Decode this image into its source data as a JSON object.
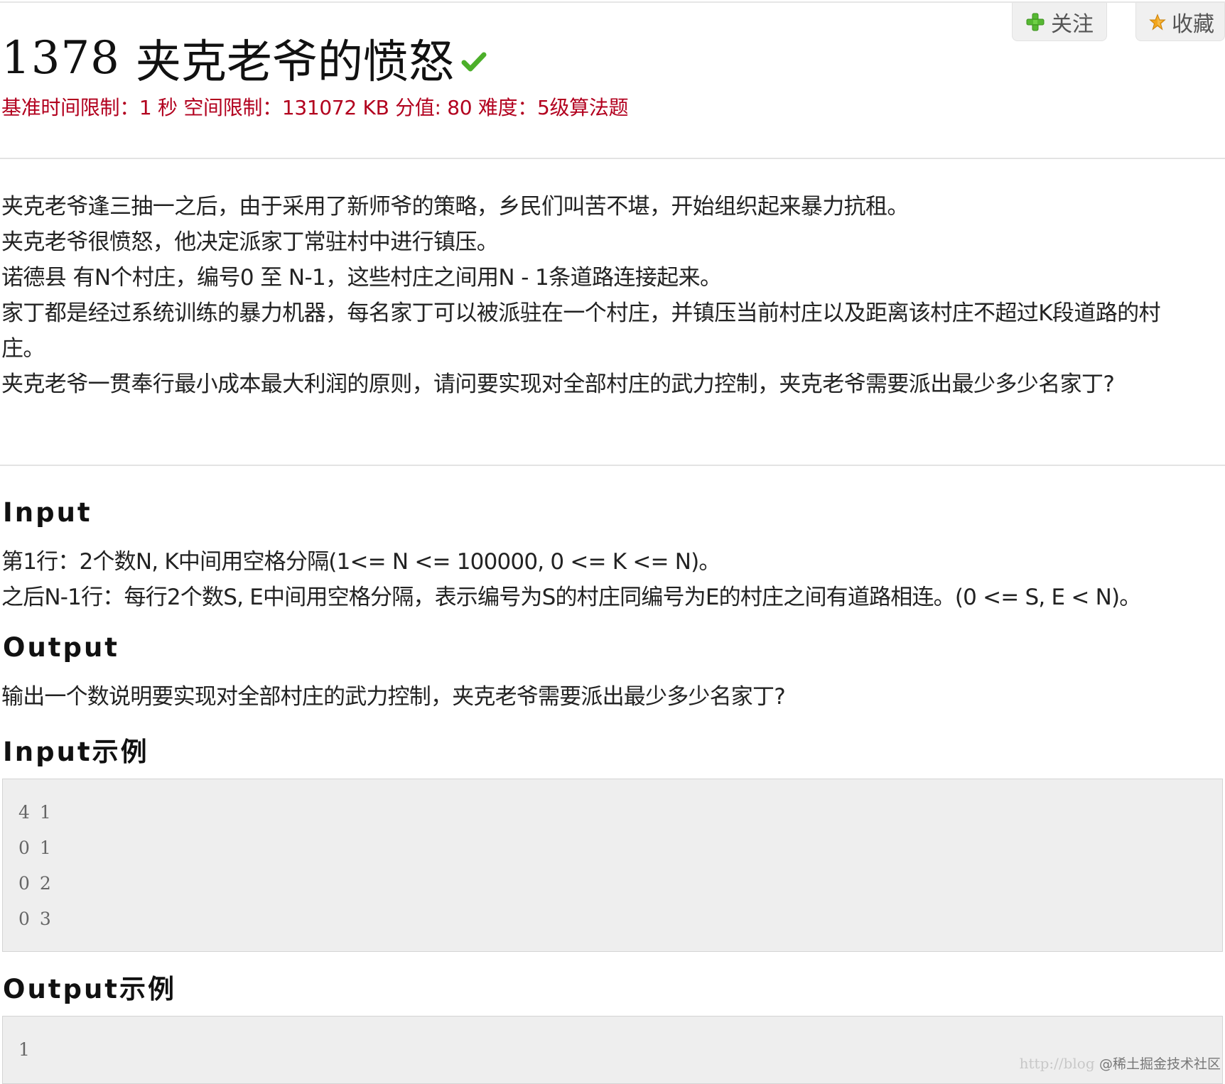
{
  "actions": {
    "follow_label": "关注",
    "favorite_label": "收藏"
  },
  "problem": {
    "id": "1378",
    "title": "夹克老爷的愤怒",
    "meta": "基准时间限制：1 秒 空间限制：131072 KB 分值: 80 难度：5级算法题"
  },
  "description": [
    "夹克老爷逢三抽一之后，由于采用了新师爷的策略，乡民们叫苦不堪，开始组织起来暴力抗租。",
    "夹克老爷很愤怒，他决定派家丁常驻村中进行镇压。",
    "诺德县 有N个村庄，编号0 至 N-1，这些村庄之间用N - 1条道路连接起来。",
    "家丁都是经过系统训练的暴力机器，每名家丁可以被派驻在一个村庄，并镇压当前村庄以及距离该村庄不超过K段道路的村",
    "庄。",
    "夹克老爷一贯奉行最小成本最大利润的原则，请问要实现对全部村庄的武力控制，夹克老爷需要派出最少多少名家丁?"
  ],
  "input_section": {
    "heading": "Input",
    "lines": [
      "第1行：2个数N, K中间用空格分隔(1<= N <= 100000, 0 <= K <= N)。",
      "之后N-1行：每行2个数S, E中间用空格分隔，表示编号为S的村庄同编号为E的村庄之间有道路相连。(0 <= S, E < N)。"
    ]
  },
  "output_section": {
    "heading": "Output",
    "lines": [
      "输出一个数说明要实现对全部村庄的武力控制，夹克老爷需要派出最少多少名家丁?"
    ]
  },
  "input_example": {
    "heading": "Input示例",
    "lines": [
      "4 1",
      "0 1",
      "0 2",
      "0 3"
    ]
  },
  "output_example": {
    "heading": "Output示例",
    "lines": [
      "1"
    ]
  },
  "watermark": {
    "url_text": "http://blog",
    "brand": "@稀土掘金技术社区"
  },
  "colors": {
    "meta_red": "#b2001e",
    "check_green": "#4caf2a",
    "plus_green": "#56b832",
    "star_gold": "#f2a51c",
    "code_bg": "#eeeeee"
  }
}
